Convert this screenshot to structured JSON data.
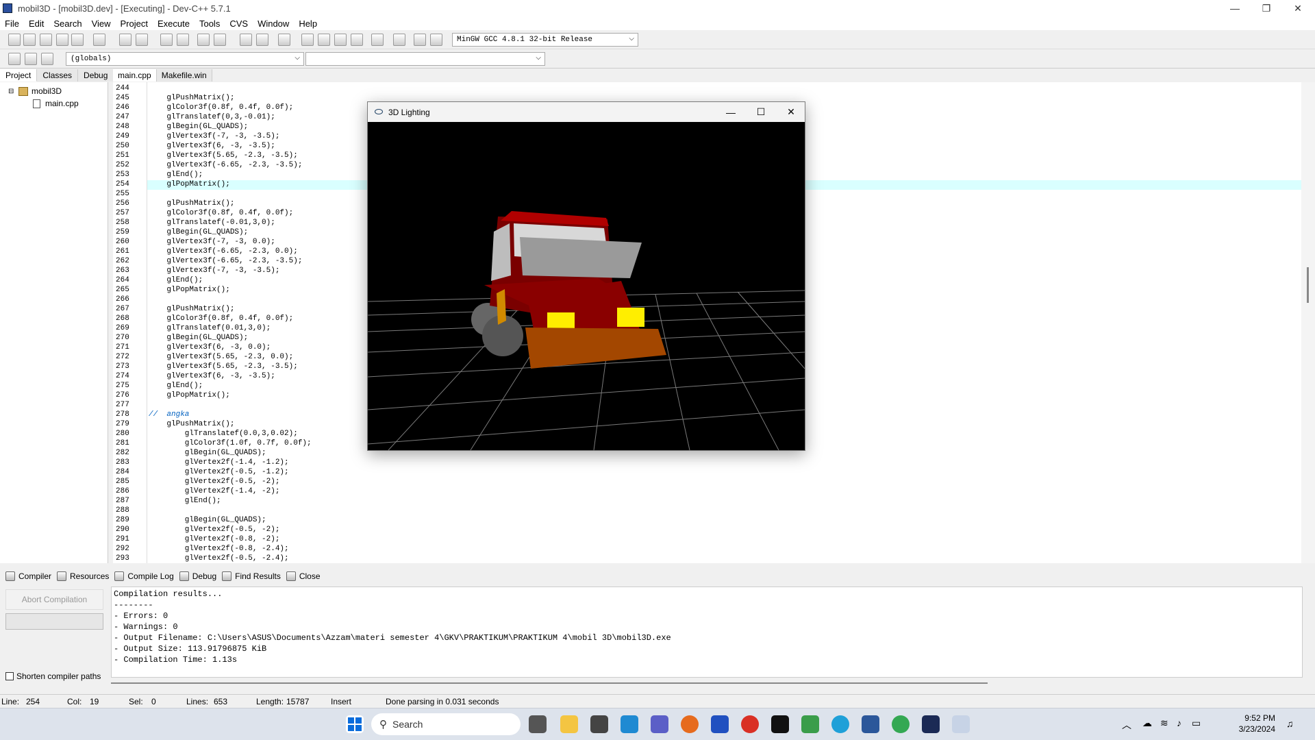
{
  "window": {
    "title": "mobil3D - [mobil3D.dev] - [Executing] - Dev-C++ 5.7.1",
    "minimize": "—",
    "maximize": "❐",
    "close": "✕"
  },
  "menu": [
    "File",
    "Edit",
    "Search",
    "View",
    "Project",
    "Execute",
    "Tools",
    "CVS",
    "Window",
    "Help"
  ],
  "toolbar": {
    "compiler_select": "MinGW GCC 4.8.1 32-bit Release",
    "scope_select": "(globals)",
    "function_select": ""
  },
  "left_panel": {
    "tabs": [
      "Project",
      "Classes",
      "Debug"
    ],
    "tree": {
      "project": "mobil3D",
      "file": "main.cpp"
    }
  },
  "editor": {
    "tabs": [
      "main.cpp",
      "Makefile.win"
    ],
    "highlight_line": 254,
    "lines": [
      {
        "n": "244",
        "code": ""
      },
      {
        "n": "245",
        "code": "    glPushMatrix();"
      },
      {
        "n": "246",
        "code": "    glColor3f(0.8f, 0.4f, 0.0f);"
      },
      {
        "n": "247",
        "code": "    glTranslatef(0,3,-0.01);"
      },
      {
        "n": "248",
        "code": "    glBegin(GL_QUADS);"
      },
      {
        "n": "249",
        "code": "    glVertex3f(-7, -3, -3.5);"
      },
      {
        "n": "250",
        "code": "    glVertex3f(6, -3, -3.5);"
      },
      {
        "n": "251",
        "code": "    glVertex3f(5.65, -2.3, -3.5);"
      },
      {
        "n": "252",
        "code": "    glVertex3f(-6.65, -2.3, -3.5);"
      },
      {
        "n": "253",
        "code": "    glEnd();"
      },
      {
        "n": "254",
        "code": "    glPopMatrix();"
      },
      {
        "n": "255",
        "code": ""
      },
      {
        "n": "256",
        "code": "    glPushMatrix();"
      },
      {
        "n": "257",
        "code": "    glColor3f(0.8f, 0.4f, 0.0f);"
      },
      {
        "n": "258",
        "code": "    glTranslatef(-0.01,3,0);"
      },
      {
        "n": "259",
        "code": "    glBegin(GL_QUADS);"
      },
      {
        "n": "260",
        "code": "    glVertex3f(-7, -3, 0.0);"
      },
      {
        "n": "261",
        "code": "    glVertex3f(-6.65, -2.3, 0.0);"
      },
      {
        "n": "262",
        "code": "    glVertex3f(-6.65, -2.3, -3.5);"
      },
      {
        "n": "263",
        "code": "    glVertex3f(-7, -3, -3.5);"
      },
      {
        "n": "264",
        "code": "    glEnd();"
      },
      {
        "n": "265",
        "code": "    glPopMatrix();"
      },
      {
        "n": "266",
        "code": ""
      },
      {
        "n": "267",
        "code": "    glPushMatrix();"
      },
      {
        "n": "268",
        "code": "    glColor3f(0.8f, 0.4f, 0.0f);"
      },
      {
        "n": "269",
        "code": "    glTranslatef(0.01,3,0);"
      },
      {
        "n": "270",
        "code": "    glBegin(GL_QUADS);"
      },
      {
        "n": "271",
        "code": "    glVertex3f(6, -3, 0.0);"
      },
      {
        "n": "272",
        "code": "    glVertex3f(5.65, -2.3, 0.0);"
      },
      {
        "n": "273",
        "code": "    glVertex3f(5.65, -2.3, -3.5);"
      },
      {
        "n": "274",
        "code": "    glVertex3f(6, -3, -3.5);"
      },
      {
        "n": "275",
        "code": "    glEnd();"
      },
      {
        "n": "276",
        "code": "    glPopMatrix();"
      },
      {
        "n": "277",
        "code": ""
      },
      {
        "n": "278",
        "code": "//  angka",
        "comment": true
      },
      {
        "n": "279",
        "code": "    glPushMatrix();"
      },
      {
        "n": "280",
        "code": "        glTranslatef(0.0,3,0.02);"
      },
      {
        "n": "281",
        "code": "        glColor3f(1.0f, 0.7f, 0.0f);"
      },
      {
        "n": "282",
        "code": "        glBegin(GL_QUADS);"
      },
      {
        "n": "283",
        "code": "        glVertex2f(-1.4, -1.2);"
      },
      {
        "n": "284",
        "code": "        glVertex2f(-0.5, -1.2);"
      },
      {
        "n": "285",
        "code": "        glVertex2f(-0.5, -2);"
      },
      {
        "n": "286",
        "code": "        glVertex2f(-1.4, -2);"
      },
      {
        "n": "287",
        "code": "        glEnd();"
      },
      {
        "n": "288",
        "code": ""
      },
      {
        "n": "289",
        "code": "        glBegin(GL_QUADS);"
      },
      {
        "n": "290",
        "code": "        glVertex2f(-0.5, -2);"
      },
      {
        "n": "291",
        "code": "        glVertex2f(-0.8, -2);"
      },
      {
        "n": "292",
        "code": "        glVertex2f(-0.8, -2.4);"
      },
      {
        "n": "293",
        "code": "        glVertex2f(-0.5, -2.4);"
      }
    ]
  },
  "gl_window": {
    "title": "3D Lighting",
    "minimize": "—",
    "maximize": "☐",
    "close": "✕"
  },
  "bottom_panel": {
    "tabs": [
      "Compiler",
      "Resources",
      "Compile Log",
      "Debug",
      "Find Results",
      "Close"
    ],
    "abort_button": "Abort Compilation",
    "shorten_paths": "Shorten compiler paths",
    "log": [
      "Compilation results...",
      "--------",
      "- Errors: 0",
      "- Warnings: 0",
      "- Output Filename: C:\\Users\\ASUS\\Documents\\Azzam\\materi semester 4\\GKV\\PRAKTIKUM\\PRAKTIKUM 4\\mobil 3D\\mobil3D.exe",
      "- Output Size: 113.91796875 KiB",
      "- Compilation Time: 1.13s"
    ]
  },
  "statusbar": {
    "line_label": "Line:",
    "line": "254",
    "col_label": "Col:",
    "col": "19",
    "sel_label": "Sel:",
    "sel": "0",
    "lines_label": "Lines:",
    "lines": "653",
    "length_label": "Length:",
    "length": "15787",
    "mode": "Insert",
    "message": "Done parsing in 0.031 seconds"
  },
  "taskbar": {
    "search_placeholder": "Search",
    "time": "9:52 PM",
    "date": "3/23/2024"
  }
}
